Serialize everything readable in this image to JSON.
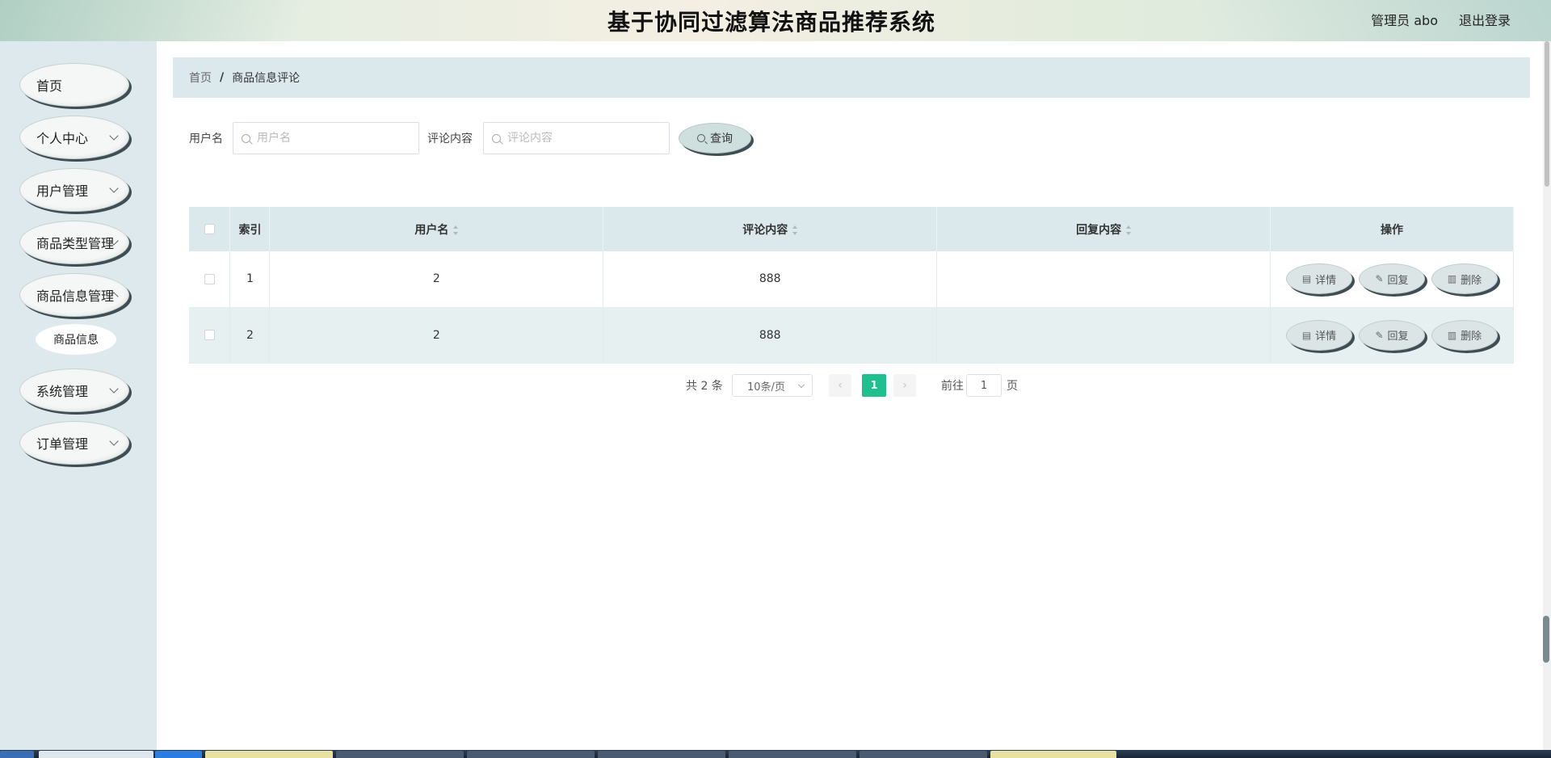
{
  "header": {
    "title": "基于协同过滤算法商品推荐系统",
    "user": "管理员 abo",
    "logout": "退出登录"
  },
  "sidebar": {
    "items": [
      {
        "label": "首页",
        "has_arrow": false
      },
      {
        "label": "个人中心",
        "has_arrow": true
      },
      {
        "label": "用户管理",
        "has_arrow": true
      },
      {
        "label": "商品类型管理",
        "has_arrow": true
      },
      {
        "label": "商品信息管理",
        "has_arrow": true
      },
      {
        "label": "系统管理",
        "has_arrow": true
      },
      {
        "label": "订单管理",
        "has_arrow": true
      }
    ],
    "sub_item": "商品信息"
  },
  "breadcrumb": {
    "home": "首页",
    "separator": "/",
    "current": "商品信息评论"
  },
  "search": {
    "username_label": "用户名",
    "username_placeholder": "用户名",
    "comment_label": "评论内容",
    "comment_placeholder": "评论内容",
    "query_button": "查询"
  },
  "table": {
    "headers": {
      "index": "索引",
      "username": "用户名",
      "comment": "评论内容",
      "reply": "回复内容",
      "actions": "操作"
    },
    "rows": [
      {
        "index": "1",
        "username": "2",
        "comment": "888",
        "reply": ""
      },
      {
        "index": "2",
        "username": "2",
        "comment": "888",
        "reply": ""
      }
    ],
    "actions": {
      "detail": "详情",
      "reply": "回复",
      "delete": "删除"
    }
  },
  "pagination": {
    "total": "共 2 条",
    "page_size": "10条/页",
    "current_page": "1",
    "goto_label": "前往",
    "goto_value": "1",
    "page_unit": "页",
    "prev": "‹",
    "next": "›"
  },
  "colors": {
    "accent": "#1fbf8f",
    "sidebar_bg": "#dde9ec",
    "table_header_bg": "#dbe9ec"
  }
}
